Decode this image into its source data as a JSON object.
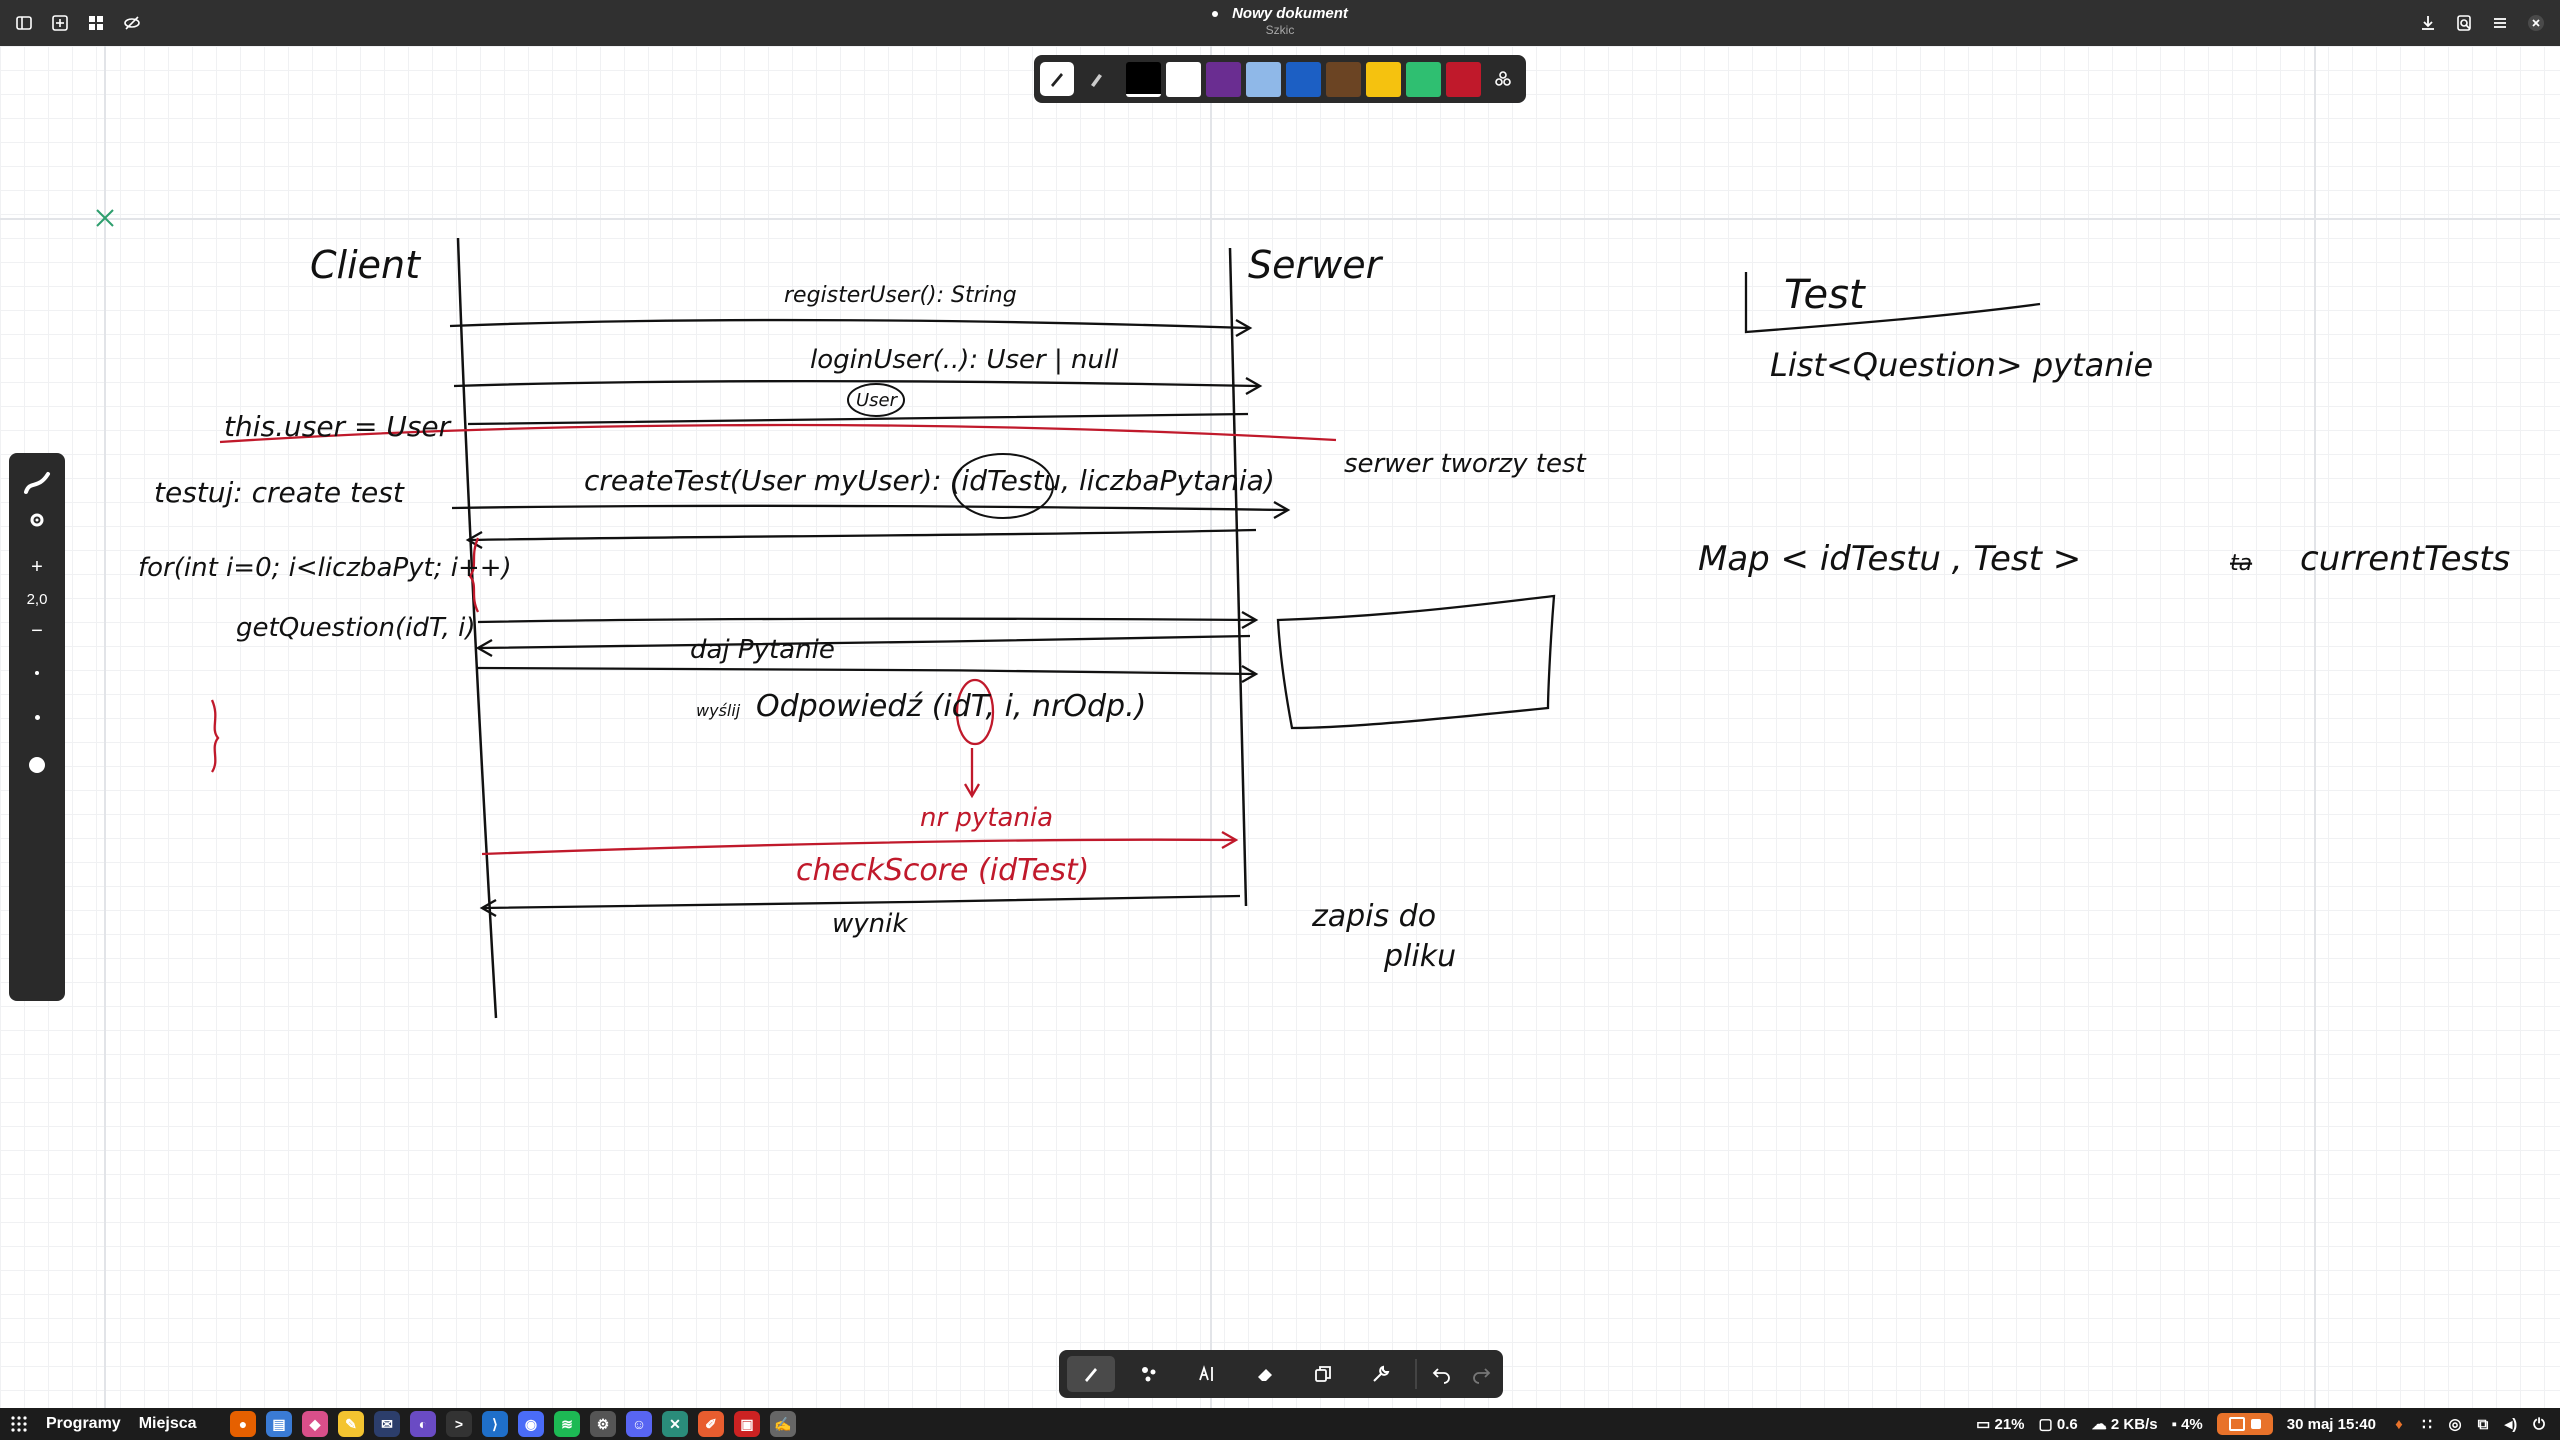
{
  "header": {
    "title": "Nowy dokument",
    "subtitle": "Szkic",
    "left_buttons": [
      "sidebar-icon",
      "new-page-icon",
      "grid-icon",
      "hide-icon"
    ],
    "right_buttons": [
      "download-icon",
      "save-icon",
      "menu-icon",
      "close-icon"
    ]
  },
  "palette": {
    "tools": [
      "pen-tool-icon",
      "highlighter-tool-icon"
    ],
    "colors": [
      "#000000",
      "#ffffff",
      "#6a2d91",
      "#8fb8e8",
      "#1c5fc4",
      "#6b4423",
      "#f5c20f",
      "#2fbf71",
      "#c0192b"
    ],
    "selected_color": "#000000",
    "extra": "palette-settings-icon"
  },
  "left_toolbar": {
    "zoom_value": "2,0",
    "zoom_in": "+",
    "zoom_out": "−"
  },
  "bottom_toolbar": {
    "tools": [
      "pen-icon",
      "shapes-icon",
      "text-icon",
      "eraser-icon",
      "copy-icon",
      "wrench-icon"
    ],
    "undo": "undo-icon",
    "redo": "redo-icon"
  },
  "taskbar": {
    "menu1": "Programy",
    "menu2": "Miejsca",
    "cpu": "21%",
    "load": "0.6",
    "net": "2 KB/s",
    "disk": "4%",
    "datetime": "30 maj 15:40"
  },
  "sketch": {
    "client": "Client",
    "server": "Serwer",
    "msg_register": "registerUser(): String",
    "msg_login": "loginUser(..): User | null",
    "label_user": "User",
    "this_user": "this.user = User",
    "testuj": "testuj: create test",
    "create_test": "createTest(User myUser): (idTestu, liczbaPytania)",
    "serwer_tworzy": "serwer tworzy test",
    "for_loop": "for(int i=0; i<liczbaPyt; i++)",
    "get_question": "getQuestion(idT, i)",
    "daj_pytanie": "daj Pytanie",
    "wyslij": "wyślij",
    "odpowiedz": "Odpowiedź (idT, i, nrOdp.)",
    "nr_pytania": "nr pytania",
    "check_score": "checkScore (idTest)",
    "wynik": "wynik",
    "zapis": "zapis do",
    "pliku": "pliku",
    "test_title": "Test",
    "list_question": "List<Question> pytanie",
    "map": "Map < idTestu , Test >",
    "current_tests": "currentTests",
    "strike": "ta"
  }
}
